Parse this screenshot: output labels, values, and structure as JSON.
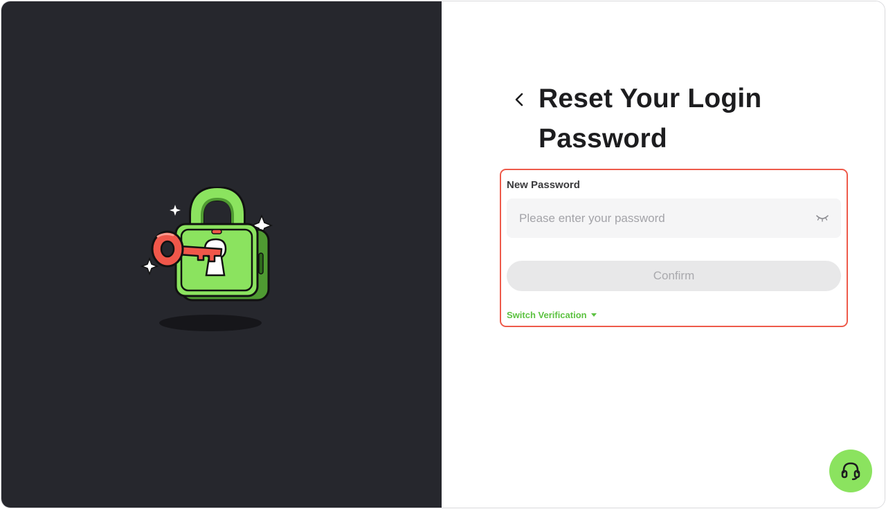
{
  "header": {
    "title": "Reset Your Login Password",
    "back_icon": "chevron-left-icon"
  },
  "form": {
    "field_label": "New Password",
    "password_placeholder": "Please enter your password",
    "password_value": "",
    "eye_icon": "eye-closed-icon",
    "confirm_label": "Confirm",
    "switch_label": "Switch Verification",
    "switch_icon": "caret-down-icon"
  },
  "support": {
    "icon": "headset-icon"
  },
  "colors": {
    "left_panel_bg": "#26272d",
    "accent_green": "#5cc241",
    "fab_green": "#8be35f",
    "highlight_red": "#ee5a4a",
    "lock_green": "#8be35f",
    "key_red": "#f0574a"
  }
}
